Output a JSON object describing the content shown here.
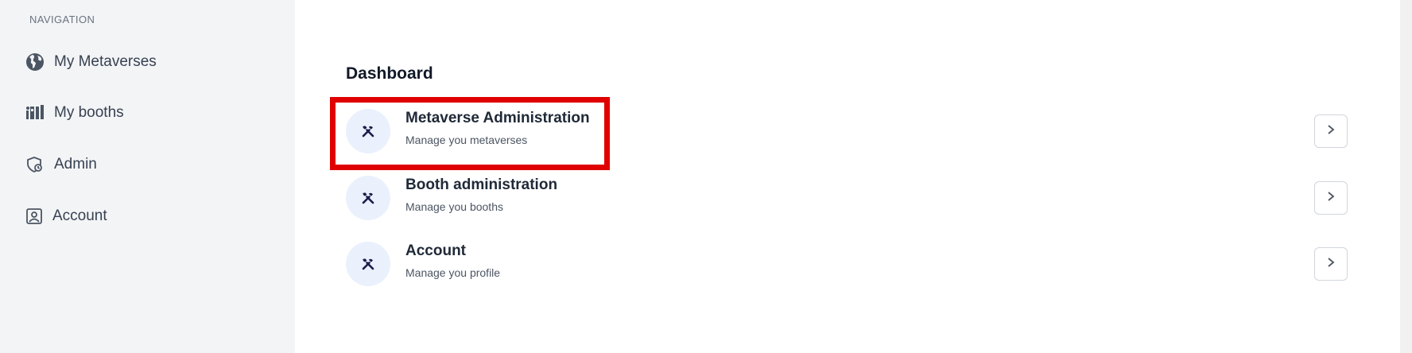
{
  "sidebar": {
    "heading": "NAVIGATION",
    "items": [
      {
        "label": "My Metaverses",
        "icon": "globe-icon"
      },
      {
        "label": "My booths",
        "icon": "booth-icon"
      },
      {
        "label": "Admin",
        "icon": "shield-icon"
      },
      {
        "label": "Account",
        "icon": "user-portrait-icon"
      }
    ]
  },
  "main": {
    "title": "Dashboard",
    "cards": [
      {
        "title": "Metaverse Administration",
        "subtitle": "Manage you metaverses",
        "icon": "tools-icon",
        "action_icon": "chevron-right-icon"
      },
      {
        "title": "Booth administration",
        "subtitle": "Manage you booths",
        "icon": "tools-icon",
        "action_icon": "chevron-right-icon"
      },
      {
        "title": "Account",
        "subtitle": "Manage you profile",
        "icon": "tools-icon",
        "action_icon": "chevron-right-icon"
      }
    ]
  },
  "colors": {
    "sidebar_bg": "#f3f4f6",
    "icon_circle_bg": "#eaf1fd",
    "icon_color": "#1e1b4b",
    "highlight": "#e00000"
  }
}
